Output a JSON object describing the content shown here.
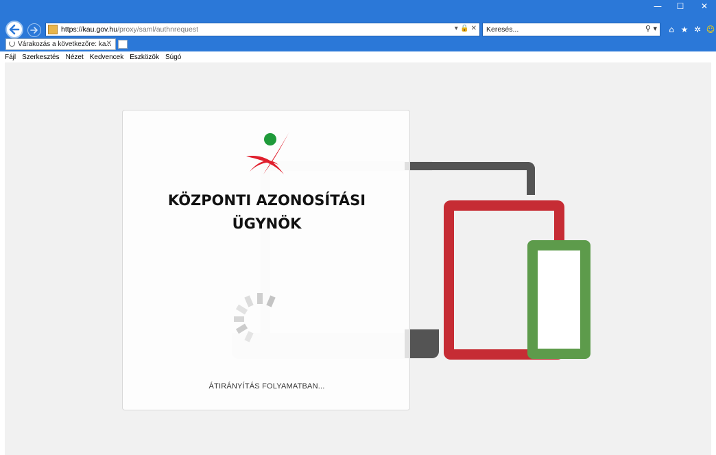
{
  "browser": {
    "url_prefix": "https://",
    "url_host": "kau.gov.hu",
    "url_path": "/proxy/saml/authnrequest",
    "search_placeholder": "Keresés...",
    "tab_title": "Várakozás a következőre: ka...",
    "window_controls": [
      "—",
      "☐",
      "✕"
    ],
    "menu": [
      "Fájl",
      "Szerkesztés",
      "Nézet",
      "Kedvencek",
      "Eszközök",
      "Súgó"
    ]
  },
  "card": {
    "title_line1": "KÖZPONTI AZONOSÍTÁSI",
    "title_line2": "ÜGYNÖK",
    "status": "ÁTIRÁNYÍTÁS FOLYAMATBAN..."
  },
  "colors": {
    "chrome_blue": "#2b78d8",
    "brand_red": "#c62c34",
    "brand_green": "#5d9b4b",
    "device_dark": "#545454"
  },
  "icons": [
    "back-arrow-icon",
    "forward-arrow-icon",
    "lock-icon",
    "search-icon",
    "home-icon",
    "star-icon",
    "gear-icon",
    "smiley-icon",
    "loading-spinner-icon"
  ]
}
